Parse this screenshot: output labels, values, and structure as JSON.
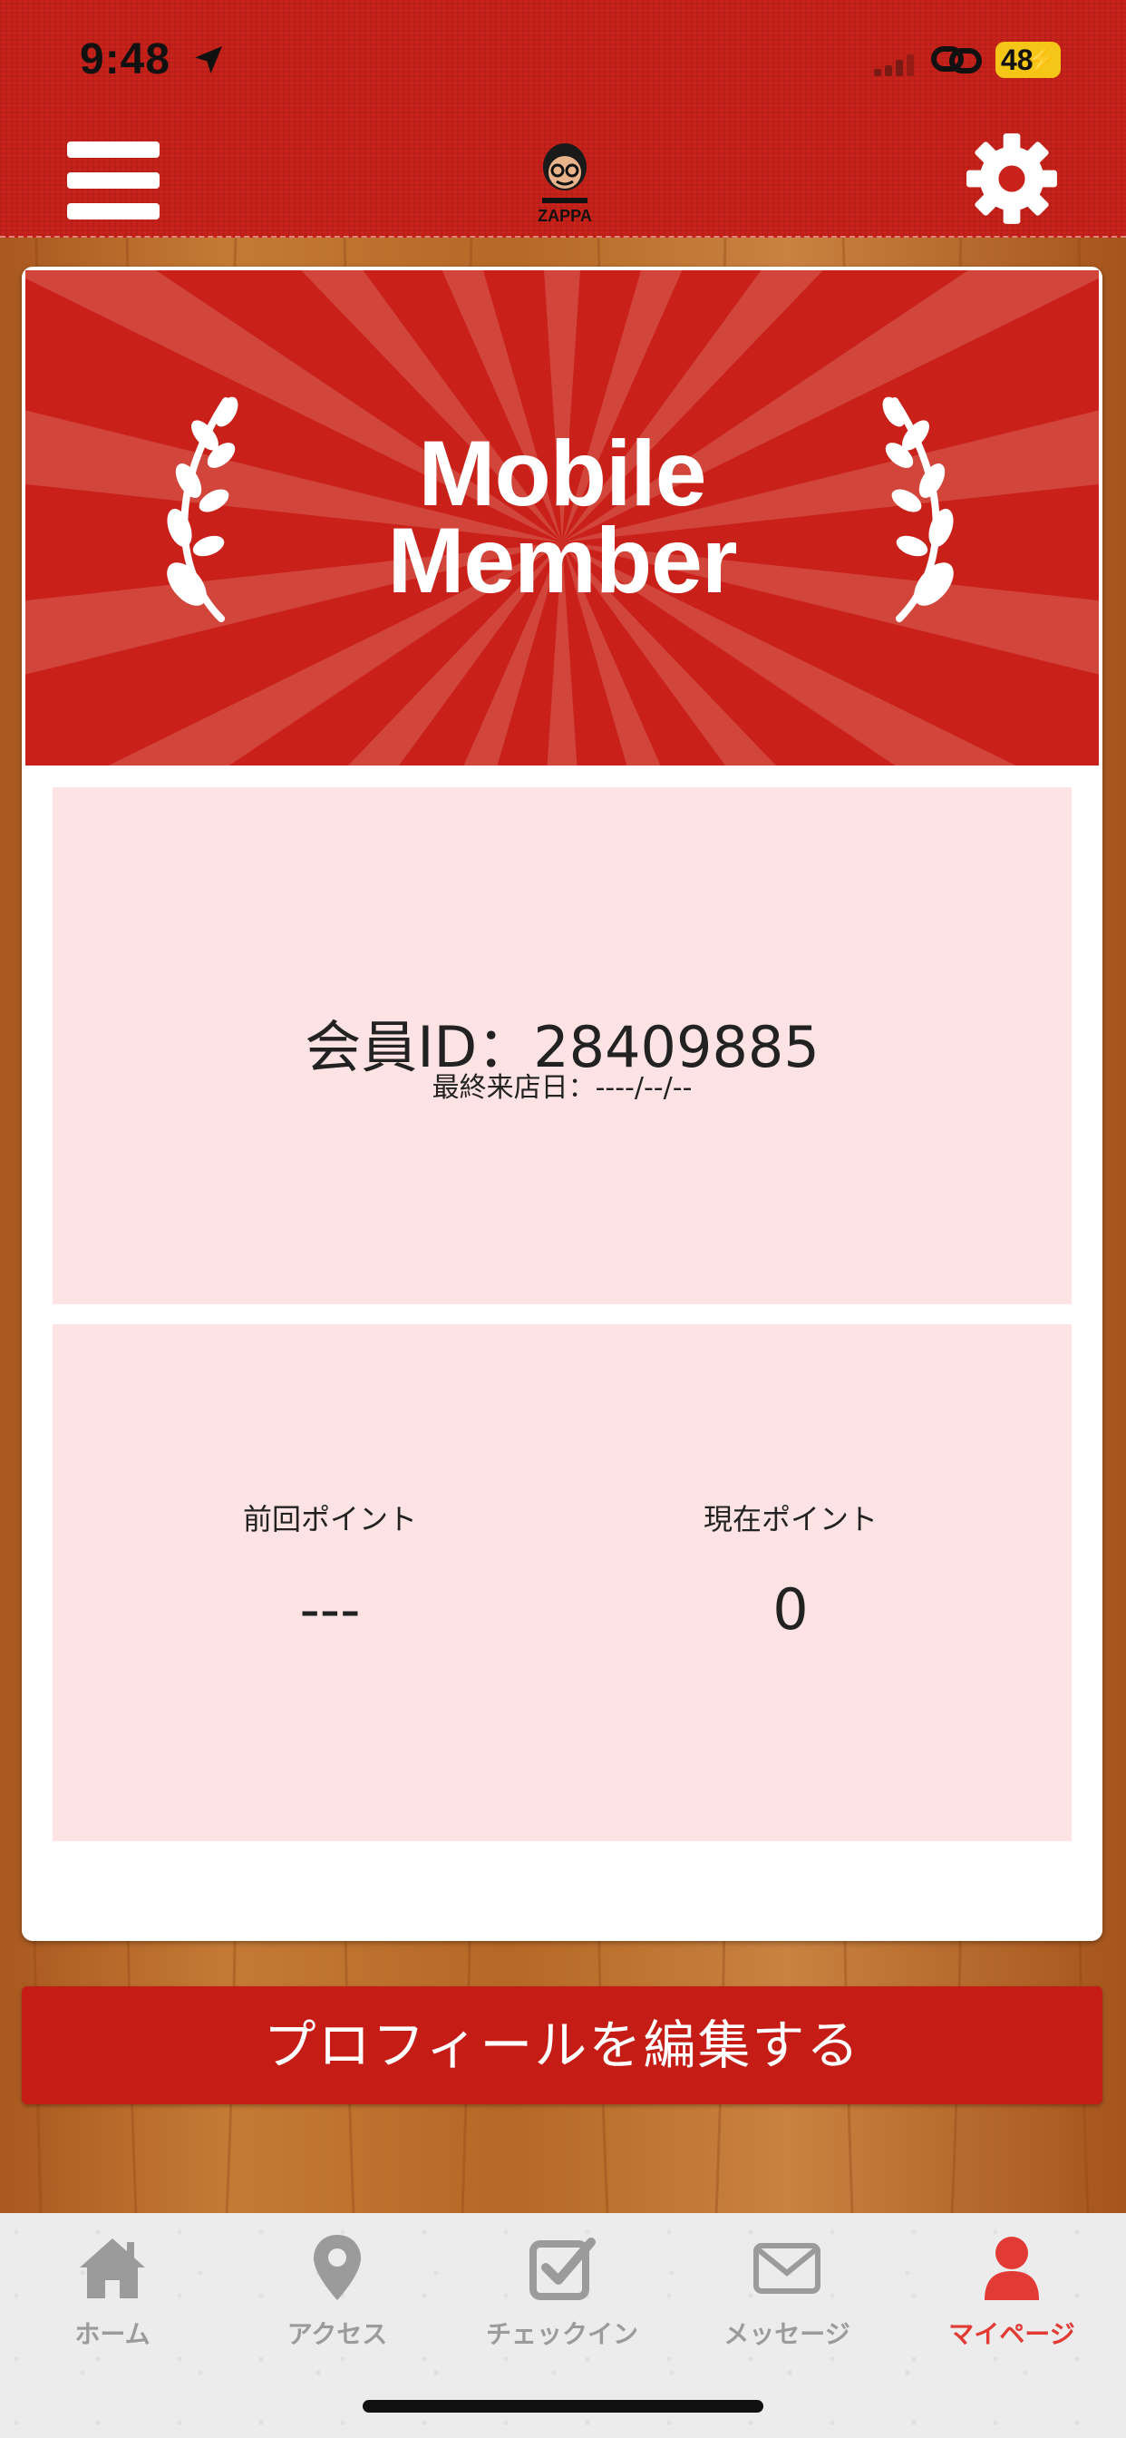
{
  "status_bar": {
    "time": "9:48",
    "battery": "48"
  },
  "header": {
    "logo_text": "ZAPPA"
  },
  "banner": {
    "title_line1": "Mobile",
    "title_line2": "Member"
  },
  "member": {
    "id_text": "会員ID：28409885",
    "last_visit": "最終来店日：----/--/--"
  },
  "points": {
    "previous_label": "前回ポイント",
    "previous_value": "---",
    "current_label": "現在ポイント",
    "current_value": "0"
  },
  "edit_profile_label": "プロフィールを編集する",
  "tabs": [
    {
      "label": "ホーム",
      "icon": "home-icon",
      "active": false
    },
    {
      "label": "アクセス",
      "icon": "map-pin-icon",
      "active": false
    },
    {
      "label": "チェックイン",
      "icon": "checkbox-icon",
      "active": false
    },
    {
      "label": "メッセージ",
      "icon": "envelope-icon",
      "active": false
    },
    {
      "label": "マイページ",
      "icon": "person-icon",
      "active": true
    }
  ],
  "colors": {
    "header_red": "#c8221a",
    "banner_red": "#c9201a",
    "panel_pink": "#fde3e3",
    "button_red": "#c51c16",
    "active_tab": "#e23b35",
    "inactive_tab": "#9b9b9b",
    "wood": "#b86a2a"
  }
}
